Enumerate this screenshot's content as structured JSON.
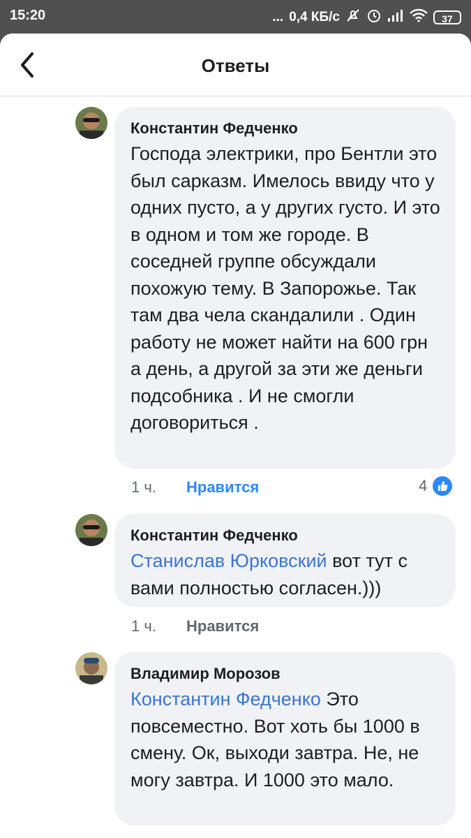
{
  "status_bar": {
    "time": "15:20",
    "dots": "...",
    "network_speed": "0,4 КБ/с",
    "battery": "37"
  },
  "header": {
    "title": "Ответы"
  },
  "comments": [
    {
      "author": "Константин Федченко",
      "mention": "",
      "text": "Господа электрики, про Бентли это был сарказм. Имелось ввиду что у одних пусто, а у других густо. И это в одном и том же городе. В соседней группе обсуждали похожую тему. В Запорожье. Так там два чела скандалили . Один работу не может найти на 600 грн а день, а другой за эти же деньги подсобника . И не смогли договориться .",
      "time": "1 ч.",
      "like_label": "Нравится",
      "like_count": "4"
    },
    {
      "author": "Константин Федченко",
      "mention": "Станислав Юрковский",
      "text": " вот тут с вами полностью согласен.)))",
      "time": "1 ч.",
      "like_label": "Нравится",
      "like_count": ""
    },
    {
      "author": "Владимир Морозов",
      "mention": "Константин Федченко",
      "text": " Это повсеместно. Вот хоть бы 1000 в смену. Ок, выходи завтра. Не, не могу завтра. И 1000 это мало.",
      "time": "",
      "like_label": "",
      "like_count": ""
    }
  ],
  "colors": {
    "accent": "#3b74d6",
    "like_active": "#2d88ff",
    "bubble": "#f0f2f5"
  }
}
